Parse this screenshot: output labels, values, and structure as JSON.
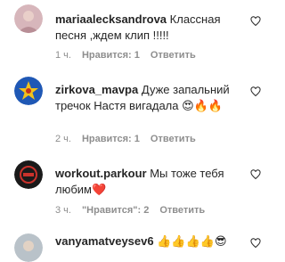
{
  "comments": [
    {
      "username": "mariaalecksandrova",
      "text": "Классная песня ,ждем клип !!!!!",
      "time": "1 ч.",
      "likes": "Нравится: 1",
      "reply": "Ответить",
      "avatar_color": "#d7b6bb"
    },
    {
      "username": "zirkova_mavpa",
      "text": "Дуже запальний тречок Настя вигадала",
      "emoji": "😍🔥🔥",
      "time": "2 ч.",
      "likes": "Нравится: 1",
      "reply": "Ответить",
      "avatar_color": "#1f58b5"
    },
    {
      "username": "workout.parkour",
      "text": "Мы тоже тебя любим",
      "emoji": "❤️",
      "time": "3 ч.",
      "likes": "\"Нравится\": 2",
      "reply": "Ответить",
      "avatar_color": "#1a1a1a"
    },
    {
      "username": "vanyamatveysev6",
      "text": "",
      "emoji": "👍👍👍👍😎",
      "avatar_color": "#b9c2c9"
    }
  ]
}
